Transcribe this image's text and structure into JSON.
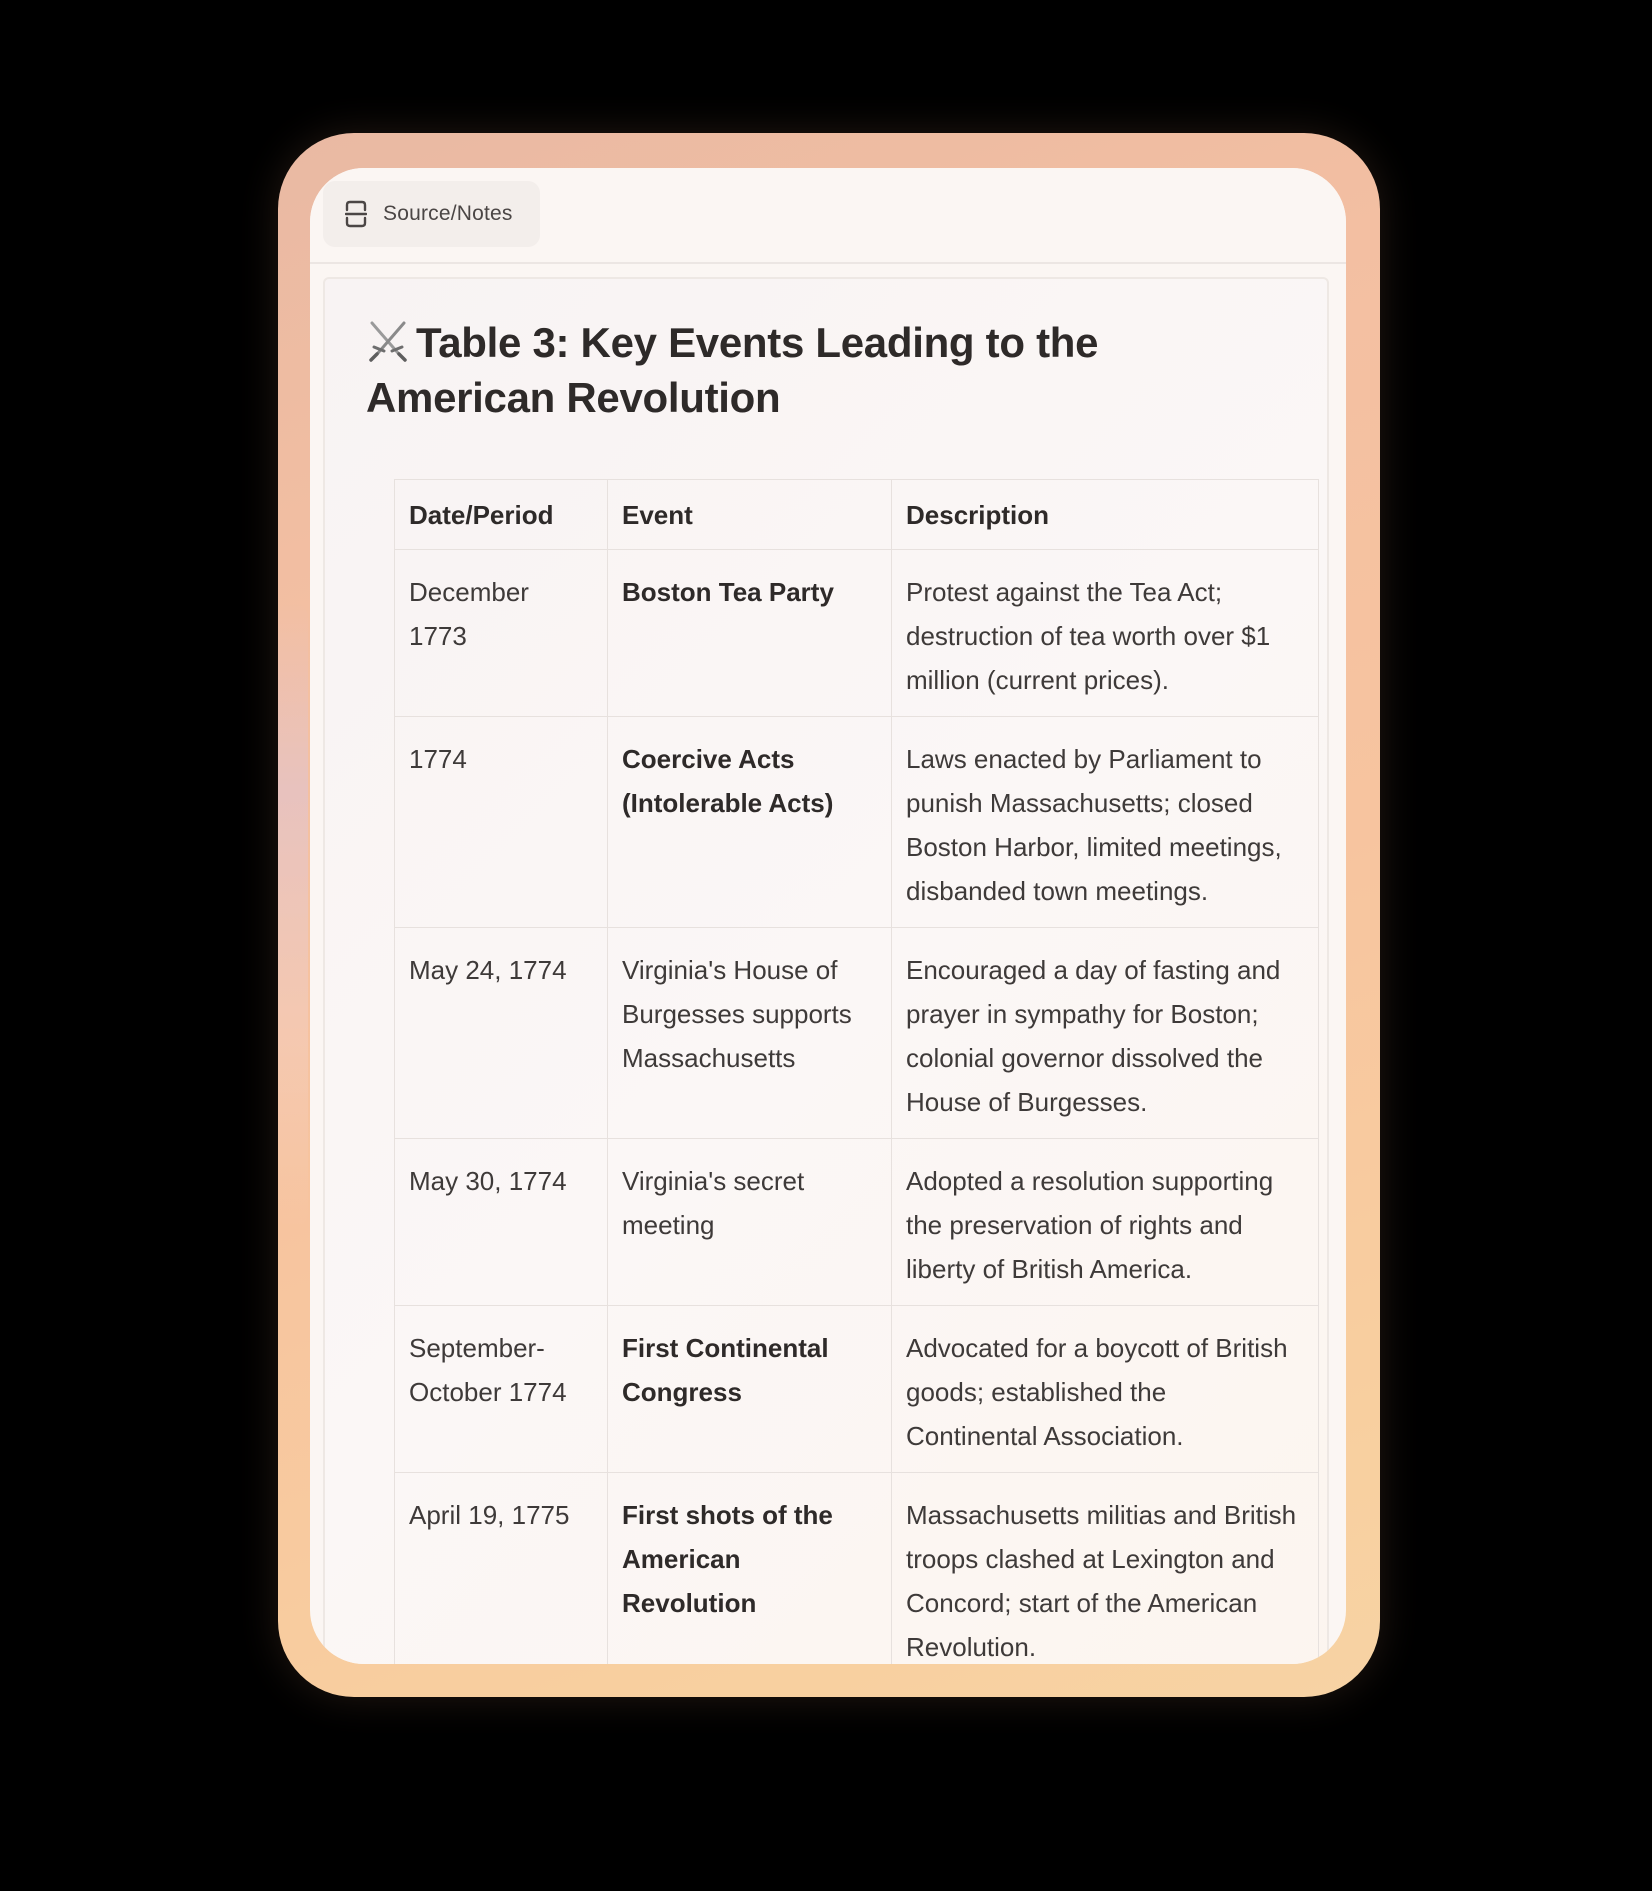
{
  "tab": {
    "label": "Source/Notes",
    "icon": "split-square-icon"
  },
  "document": {
    "title_icon": "crossed-swords-icon",
    "title": "Table 3: Key Events Leading to the American Revolution"
  },
  "table": {
    "headers": [
      "Date/Period",
      "Event",
      "Description"
    ],
    "rows": [
      {
        "date": "December 1773",
        "event": "Boston Tea Party",
        "event_bold": true,
        "description": "Protest against the Tea Act; destruction of tea worth over $1 million (current prices)."
      },
      {
        "date": "1774",
        "event": "Coercive Acts (Intolerable Acts)",
        "event_bold": true,
        "description": "Laws enacted by Parliament to punish Massachusetts; closed Boston Harbor, limited meetings, disbanded town meetings."
      },
      {
        "date": "May 24, 1774",
        "event": "Virginia's House of Burgesses supports Massachusetts",
        "event_bold": false,
        "description": "Encouraged a day of fasting and prayer in sympathy for Boston; colonial governor dissolved the House of Burgesses."
      },
      {
        "date": "May 30, 1774",
        "event": "Virginia's secret meeting",
        "event_bold": false,
        "description": "Adopted a resolution supporting the preservation of rights and liberty of British America."
      },
      {
        "date": "September-October 1774",
        "event": "First Continental Congress",
        "event_bold": true,
        "description": "Advocated for a boycott of British goods; established the Continental Association."
      },
      {
        "date": "April 19, 1775",
        "event": "First shots of the American Revolution",
        "event_bold": true,
        "description": "Massachusetts militias and British troops clashed at Lexington and Concord; start of the American Revolution."
      }
    ]
  },
  "colors": {
    "frame_gradient_start": "#e9b9a3",
    "frame_gradient_end": "#f7d3a4",
    "card_background": "#fbf6f3",
    "text_primary": "#2e2a29",
    "border": "#e7e1de"
  }
}
